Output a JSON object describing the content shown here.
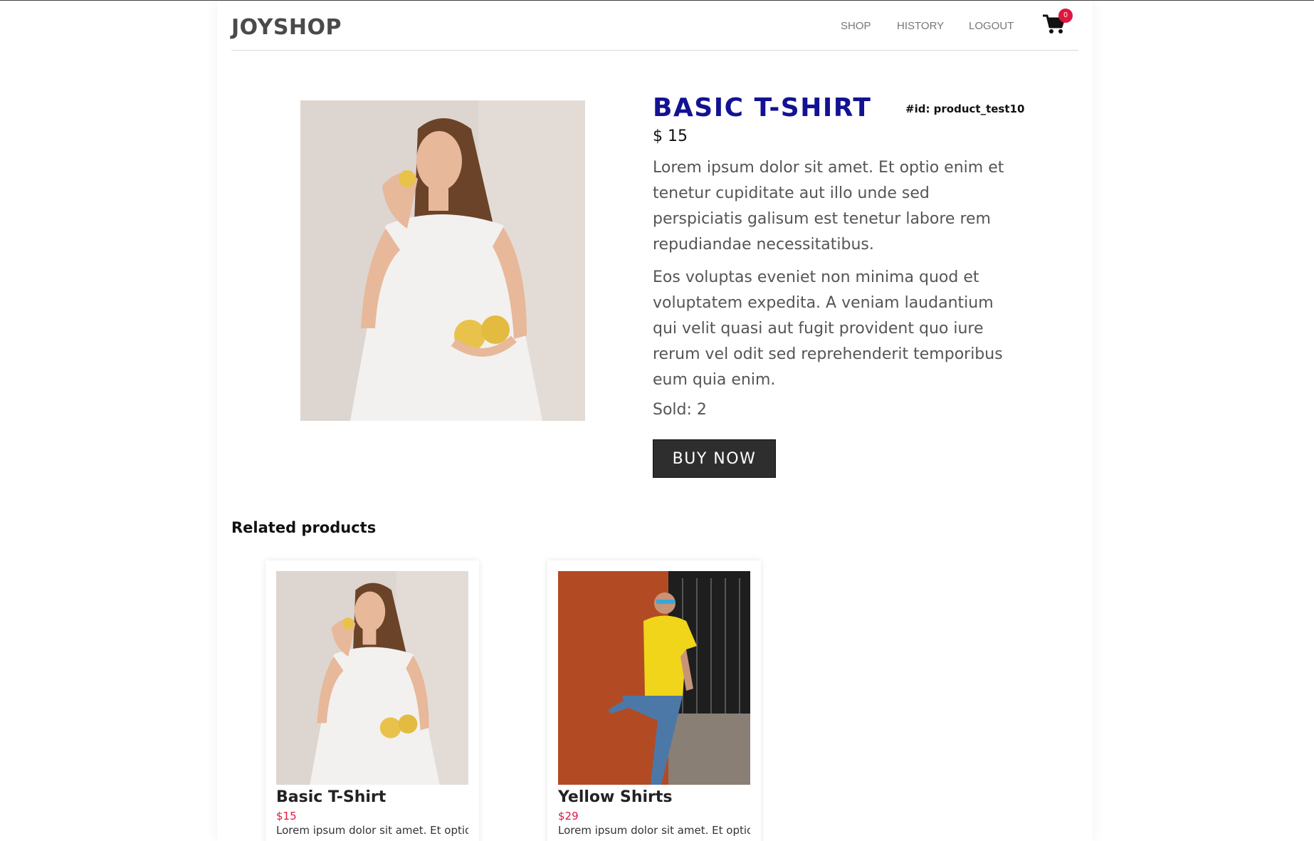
{
  "header": {
    "brand": "JOYSHOP",
    "nav": [
      {
        "label": "SHOP"
      },
      {
        "label": "HISTORY"
      },
      {
        "label": "LOGOUT"
      }
    ],
    "cart_icon": "shopping-cart-icon",
    "cart_count": "0"
  },
  "product": {
    "title": "BASIC T-SHIRT",
    "id_label": "#id: product_test10",
    "price": "$ 15",
    "description_1": "Lorem ipsum dolor sit amet. Et optio enim et tenetur cupiditate aut illo unde sed perspiciatis galisum est tenetur labore rem repudiandae necessitatibus.",
    "description_2": "Eos voluptas eveniet non minima quod et voluptatem expedita. A veniam laudantium qui velit quasi aut fugit provident quo iure rerum vel odit sed reprehenderit temporibus eum quia enim.",
    "sold": "Sold: 2",
    "buy_label": "BUY NOW"
  },
  "related": {
    "heading": "Related products",
    "items": [
      {
        "name": "Basic T-Shirt",
        "price": "$15",
        "desc": "Lorem ipsum dolor sit amet. Et optio"
      },
      {
        "name": "Yellow Shirts",
        "price": "$29",
        "desc": "Lorem ipsum dolor sit amet. Et optio"
      }
    ]
  },
  "colors": {
    "title": "#121293",
    "accent": "#e0163f",
    "button": "#2e2e2e"
  }
}
